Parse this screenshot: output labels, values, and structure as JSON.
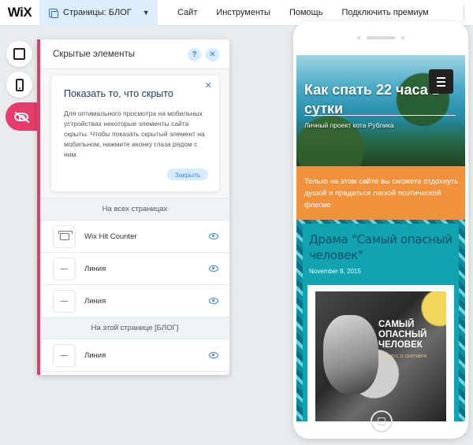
{
  "app": {
    "logo": "WiX"
  },
  "topbar": {
    "pages_label": "Страницы: БЛОГ",
    "menu": [
      "Сайт",
      "Инструменты",
      "Помощь",
      "Подключить премиум"
    ]
  },
  "panel": {
    "title": "Скрытые элементы",
    "help_label": "?",
    "close_label": "✕",
    "intro": {
      "title": "Показать то, что скрыто",
      "text": "Для оптимального просмотра на мобильных устройствах некоторые элементы сайта скрыты. Чтобы показать скрытый элемент на мобильном, нажмите иконку глаза рядом с ним.",
      "close_label": "✕",
      "button": "Закрыть"
    },
    "sections": [
      {
        "heading": "На всех страницах",
        "items": [
          {
            "label": "Wix Hit Counter",
            "icon": "counter-icon"
          },
          {
            "label": "Линия",
            "icon": "line-icon"
          },
          {
            "label": "Линия",
            "icon": "line-icon"
          }
        ]
      },
      {
        "heading": "На этой странице [БЛОГ]",
        "items": [
          {
            "label": "Линия",
            "icon": "line-icon"
          }
        ]
      }
    ]
  },
  "preview": {
    "site_title": "Как спать 22 часа в сутки",
    "site_subtitle": "Личный проект кота Рублика",
    "promo_text": "Только на этом сайте вы сможете отдохнуть душой и предаться легкой поэтической флегме",
    "post_title": "Драма \"Самый опасный человек\"",
    "post_date": "November 8, 2015",
    "poster_title": "САМЫЙ ОПАСНЫЙ ЧЕЛОВЕК",
    "poster_sub": "В КИНО С 11 СЕНТЯБРЯ"
  },
  "colors": {
    "accent": "#e53d6b",
    "blue": "#3b86d6",
    "promo": "#f2913c",
    "teal": "#12a3b0"
  }
}
